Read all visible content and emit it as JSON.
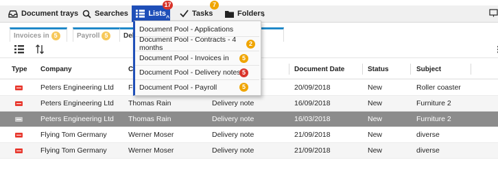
{
  "toolbar": {
    "document_trays": "Document trays",
    "searches": "Searches",
    "lists": "Lists",
    "lists_badge": "17",
    "tasks": "Tasks",
    "tasks_badge": "7",
    "folders": "Folders"
  },
  "tabs": [
    {
      "label": "Invoices in",
      "badge": "5"
    },
    {
      "label": "Payroll",
      "badge": "5"
    },
    {
      "label": "Deli",
      "badge": ""
    }
  ],
  "lists_menu": [
    {
      "label": "Document Pool - Applications",
      "badge": "",
      "badge_color": ""
    },
    {
      "label": "Document Pool - Contracts - 4 months",
      "badge": "2",
      "badge_color": "#f0a500"
    },
    {
      "label": "Document Pool - Invoices in",
      "badge": "5",
      "badge_color": "#f0a500"
    },
    {
      "label": "Document Pool - Delivery notes",
      "badge": "5",
      "badge_color": "#d9342b"
    },
    {
      "label": "Document Pool - Payroll",
      "badge": "5",
      "badge_color": "#f0a500"
    }
  ],
  "table": {
    "columns": [
      "Type",
      "Company",
      "C",
      "",
      "Document Date",
      "Status",
      "Subject"
    ],
    "rows": [
      {
        "company": "Peters Engineering Ltd",
        "contact": "F",
        "doctype": "",
        "date": "20/09/2018",
        "status": "New",
        "subject": "Roller coaster",
        "selected": false
      },
      {
        "company": "Peters Engineering Ltd",
        "contact": "Thomas Rain",
        "doctype": "Delivery note",
        "date": "16/09/2018",
        "status": "New",
        "subject": "Furniture 2",
        "selected": false
      },
      {
        "company": "Peters Engineering Ltd",
        "contact": "Thomas Rain",
        "doctype": "Delivery note",
        "date": "16/03/2018",
        "status": "New",
        "subject": "Furniture 2",
        "selected": true
      },
      {
        "company": "Flying Tom Germany",
        "contact": "Werner Moser",
        "doctype": "Delivery note",
        "date": "21/09/2018",
        "status": "New",
        "subject": "diverse",
        "selected": false
      },
      {
        "company": "Flying Tom Germany",
        "contact": "Werner Moser",
        "doctype": "Delivery note",
        "date": "21/09/2018",
        "status": "New",
        "subject": "diverse",
        "selected": false
      }
    ]
  },
  "colors": {
    "accent": "#1f4fb8",
    "tab_accent": "#1e88c8",
    "selected_row": "#8c8c8c",
    "badge_red": "#d9342b",
    "badge_orange": "#f0a500"
  },
  "icons": [
    "tray-icon",
    "search-icon",
    "list-icon",
    "checkmark-icon",
    "folder-icon",
    "list-view-icon",
    "sort-icon",
    "pdf-icon"
  ]
}
